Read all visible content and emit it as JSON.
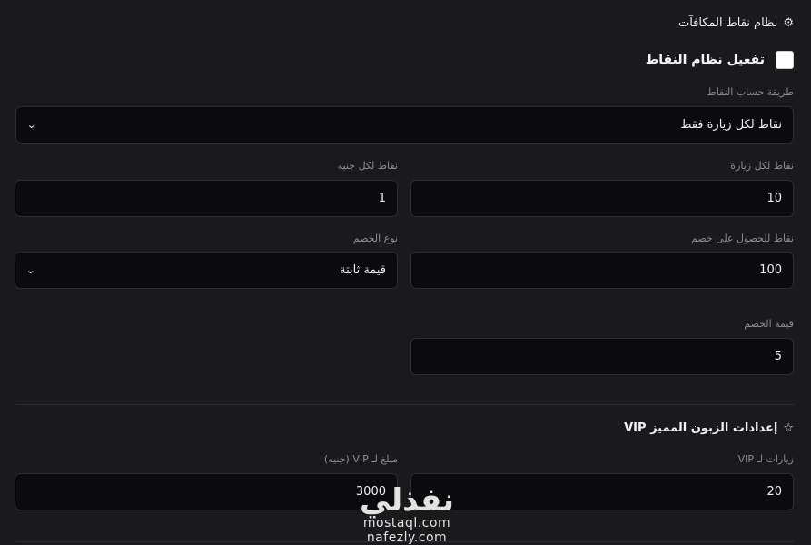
{
  "points_section": {
    "title": "نظام نقاط المكافآت",
    "icon": "gear-icon",
    "enable_label": "تفعيل نظام النقاط",
    "calc_method_label": "طريقة حساب النقاط",
    "calc_method_value": "نقاط لكل زيارة فقط",
    "points_per_visit_label": "نقاط لكل زيارة",
    "points_per_visit_value": "10",
    "points_per_pound_label": "نقاط لكل جنيه",
    "points_per_pound_value": "1",
    "points_for_discount_label": "نقاط للحصول على خصم",
    "points_for_discount_value": "100",
    "discount_type_label": "نوع الخصم",
    "discount_type_value": "قيمة ثابتة",
    "discount_value_label": "قيمة الخصم",
    "discount_value_value": "5"
  },
  "vip_section": {
    "title": "إعدادات الزبون المميز VIP",
    "icon": "star-icon",
    "visits_label": "زيارات لـ VIP",
    "visits_value": "20",
    "amount_label": "مبلغ لـ VIP (جنيه)",
    "amount_value": "3000"
  },
  "watermark": {
    "main": "نفذلي",
    "site1": "mostaql.com",
    "site2": "nafezly.com"
  }
}
